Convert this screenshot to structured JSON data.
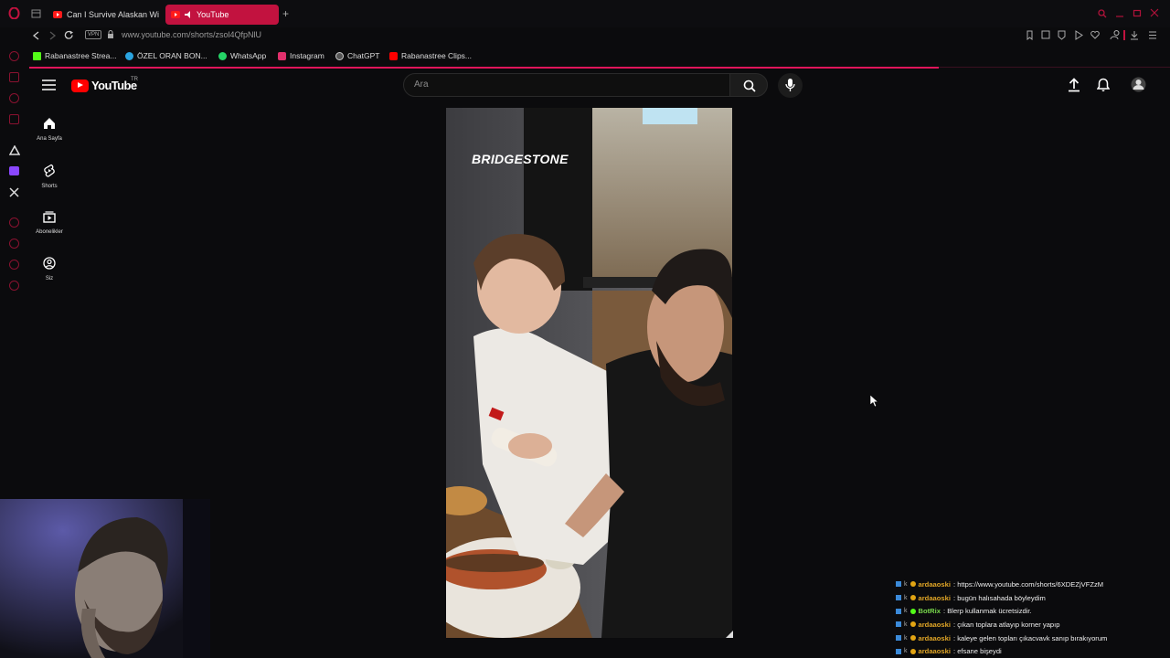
{
  "browser": {
    "tabs": [
      {
        "label": "Can I Survive Alaskan Wi",
        "active": false
      },
      {
        "label": "YouTube",
        "active": true
      }
    ],
    "new_tab_label": "+",
    "vpn_badge": "VPN",
    "url": "www.youtube.com/shorts/zsol4QfpNlU",
    "bookmarks": [
      {
        "label": "Rabanastree Strea...",
        "icon": "kick-icon",
        "color": "#53fc18"
      },
      {
        "label": "ÖZEL ORAN BON...",
        "icon": "telegram-icon",
        "color": "#2aa3df"
      },
      {
        "label": "WhatsApp",
        "icon": "whatsapp-icon",
        "color": "#25d366"
      },
      {
        "label": "Instagram",
        "icon": "instagram-icon",
        "color": "#e1306c"
      },
      {
        "label": "ChatGPT",
        "icon": "chatgpt-icon",
        "color": "#cccccc"
      },
      {
        "label": "Rabanastree Clips...",
        "icon": "youtube-icon",
        "color": "#ff0000"
      }
    ],
    "accent": "#e0155a"
  },
  "youtube": {
    "logo_text": "YouTube",
    "country": "TR",
    "search_placeholder": "Ara",
    "guide": [
      {
        "label": "Ana Sayfa",
        "icon": "home-icon"
      },
      {
        "label": "Shorts",
        "icon": "shorts-icon"
      },
      {
        "label": "Abonelikler",
        "icon": "subscriptions-icon"
      },
      {
        "label": "Siz",
        "icon": "you-icon"
      }
    ],
    "video_overlay_brand": "BRIDGESTONE"
  },
  "chat": [
    {
      "user": "ardaaoski",
      "user_color": "#e0a526",
      "message": ": https://www.youtube.com/shorts/6XDEZjVFZzM"
    },
    {
      "user": "ardaaoski",
      "user_color": "#e0a526",
      "message": ": bugün halısahada böyleydim"
    },
    {
      "user": "BotRix",
      "user_color": "#7ad94c",
      "message": ": Blerp kullanmak ücretsizdir."
    },
    {
      "user": "ardaaoski",
      "user_color": "#e0a526",
      "message": ": çıkan toplara atlayıp korner yapıp"
    },
    {
      "user": "ardaaoski",
      "user_color": "#e0a526",
      "message": ": kaleye gelen topları çıkacvavk sanıp bırakıyorum"
    },
    {
      "user": "ardaaoski",
      "user_color": "#e0a526",
      "message": ": efsane bişeydi"
    }
  ]
}
